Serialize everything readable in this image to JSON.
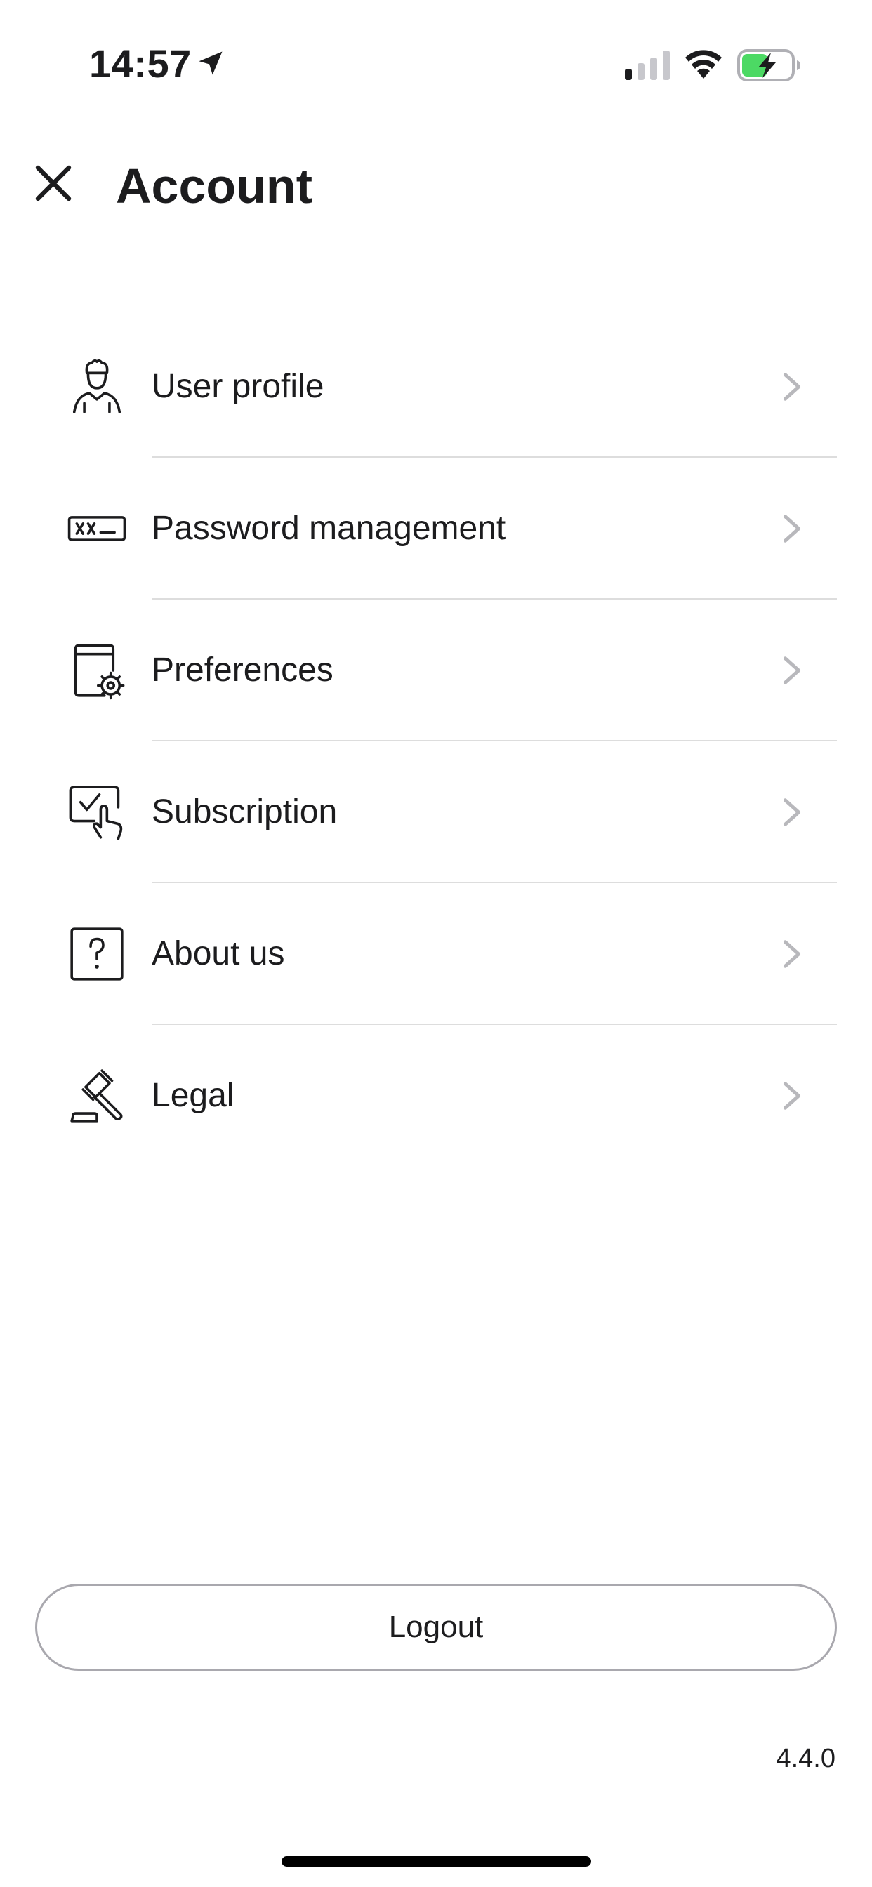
{
  "status_bar": {
    "time": "14:57",
    "icons": [
      "location-arrow-icon",
      "cellular-signal-icon",
      "wifi-icon",
      "battery-charging-icon"
    ],
    "battery_color": "#4cd964"
  },
  "header": {
    "close_icon": "close-icon",
    "title": "Account"
  },
  "menu": {
    "items": [
      {
        "label": "User profile",
        "icon": "user-profile-icon"
      },
      {
        "label": "Password management",
        "icon": "password-icon"
      },
      {
        "label": "Preferences",
        "icon": "preferences-gear-icon"
      },
      {
        "label": "Subscription",
        "icon": "subscription-touch-icon"
      },
      {
        "label": "About us",
        "icon": "question-box-icon"
      },
      {
        "label": "Legal",
        "icon": "gavel-icon"
      }
    ],
    "chevron_icon": "chevron-right-icon",
    "chevron_color": "#b8b8bc"
  },
  "footer": {
    "logout_label": "Logout",
    "version": "4.4.0"
  }
}
